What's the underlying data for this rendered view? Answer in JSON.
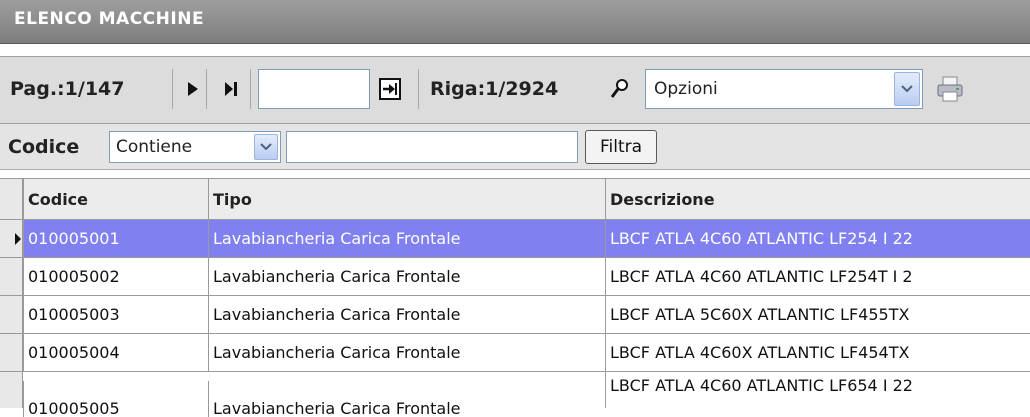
{
  "window": {
    "title": "ELENCO MACCHINE"
  },
  "toolbar": {
    "page_label": "Pag.:1/147",
    "next_icon": "play-next-icon",
    "last_icon": "skip-last-icon",
    "goto_value": "",
    "goto_icon": "enter-arrow-icon",
    "row_label": "Riga:1/2924",
    "search_icon": "magnifier-icon",
    "options_value": "Opzioni",
    "print_icon": "printer-icon"
  },
  "filter": {
    "field_label": "Codice",
    "condition_value": "Contiene",
    "text_value": "",
    "button_label": "Filtra"
  },
  "grid": {
    "columns": [
      "Codice",
      "Tipo",
      "Descrizione"
    ],
    "rows": [
      {
        "codice": "010005001",
        "tipo": "Lavabiancheria Carica Frontale",
        "descrizione": "LBCF ATLA 4C60 ATLANTIC LF254 I 22"
      },
      {
        "codice": "010005002",
        "tipo": "Lavabiancheria Carica Frontale",
        "descrizione": "LBCF ATLA 4C60 ATLANTIC LF254T I 2"
      },
      {
        "codice": "010005003",
        "tipo": "Lavabiancheria Carica Frontale",
        "descrizione": "LBCF ATLA 5C60X ATLANTIC LF455TX"
      },
      {
        "codice": "010005004",
        "tipo": "Lavabiancheria Carica Frontale",
        "descrizione": "LBCF ATLA 4C60X ATLANTIC LF454TX"
      },
      {
        "codice": "010005005",
        "tipo": "Lavabiancheria Carica Frontale",
        "descrizione": "LBCF ATLA 4C60 ATLANTIC LF654 I 22"
      }
    ],
    "selected_index": 0
  },
  "colors": {
    "selected_row": "#8080f0",
    "title_bar": "#8c8c8c"
  }
}
